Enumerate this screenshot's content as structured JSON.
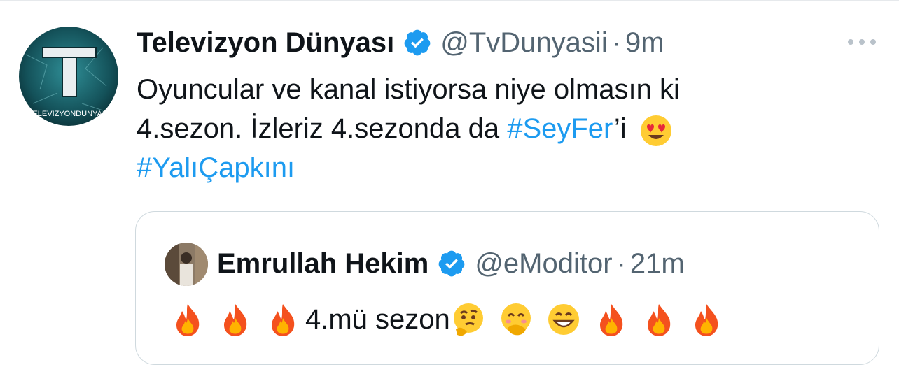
{
  "tweet": {
    "display_name": "Televizyon Dünyası",
    "handle": "@TvDunyasii",
    "separator": "·",
    "time": "9m",
    "avatar_text": "TELEVIZYONDUNYASI",
    "avatar_letter": "T",
    "text_line1": "Oyuncular ve kanal istiyorsa niye olmasın ki",
    "text_line2_a": "4.sezon. İzleriz 4.sezonda da ",
    "hashtag1": "#SeyFer",
    "text_line2_b": "’i",
    "hashtag2": "#YalıÇapkını"
  },
  "quote": {
    "display_name": "Emrullah Hekim",
    "handle": "@eModitor",
    "separator": "·",
    "time": "21m",
    "text": "4.mü sezon"
  },
  "colors": {
    "link": "#1d9bf0",
    "verified": "#1d9bf0",
    "secondary_text": "#536471",
    "primary_text": "#0f1419",
    "border": "#cfd9de"
  },
  "icons": {
    "verified": "verified-badge-icon",
    "more": "more-dots-icon",
    "heart_eyes": "heart-eyes-emoji-icon",
    "fire": "fire-emoji-icon",
    "thinking": "thinking-emoji-icon",
    "hand_over_mouth": "hand-over-mouth-emoji-icon",
    "grin": "grinning-emoji-icon"
  }
}
